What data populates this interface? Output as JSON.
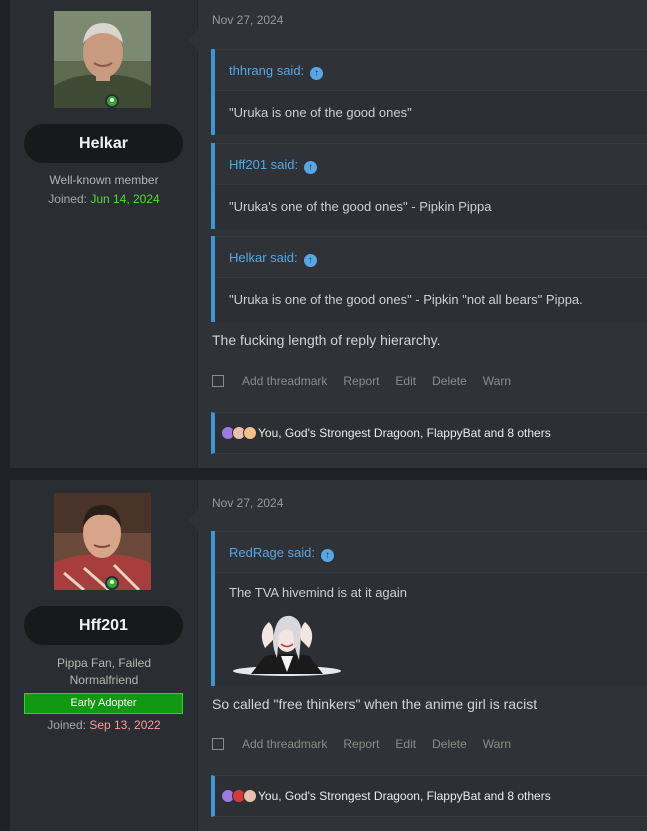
{
  "posts": [
    {
      "user": {
        "name": "Helkar",
        "title": "Well-known member",
        "joined_label": "Joined:",
        "joined_date": "Jun 14, 2024"
      },
      "date": "Nov 27, 2024",
      "quotes": [
        {
          "author": "thhrang said:",
          "text": "\"Uruka is one of the good ones\""
        },
        {
          "author": "Hff201 said:",
          "text": "\"Uruka's one of the good ones\" - Pipkin Pippa"
        },
        {
          "author": "Helkar said:",
          "text": "\"Uruka is one of the good ones\" - Pipkin \"not all bears\" Pippa."
        }
      ],
      "text": "The fucking length of reply hierarchy.",
      "actions": [
        "Add threadmark",
        "Report",
        "Edit",
        "Delete",
        "Warn"
      ],
      "reactions": "You, God's Strongest Dragoon, FlappyBat and 8 others"
    },
    {
      "user": {
        "name": "Hff201",
        "title": "Pippa Fan, Failed Normalfriend",
        "badge": "Early Adopter",
        "joined_label": "Joined:",
        "joined_date": "Sep 13, 2022"
      },
      "date": "Nov 27, 2024",
      "quotes": [
        {
          "author": "RedRage said:",
          "text": "The TVA hivemind is at it again"
        }
      ],
      "text": "So called \"free thinkers\" when the anime girl is racist",
      "actions": [
        "Add threadmark",
        "Report",
        "Edit",
        "Delete",
        "Warn"
      ],
      "reactions": "You, God's Strongest Dragoon, FlappyBat and 8 others"
    }
  ],
  "colors": {
    "accent": "#3f94d3",
    "link": "#55a8e5",
    "joined_green": "#55dd33",
    "joined_pink": "#ff9aa0",
    "badge_green": "#119911"
  },
  "icons": {
    "quote_jump": "arrow-up-circle-icon",
    "online": "online-status-icon"
  }
}
